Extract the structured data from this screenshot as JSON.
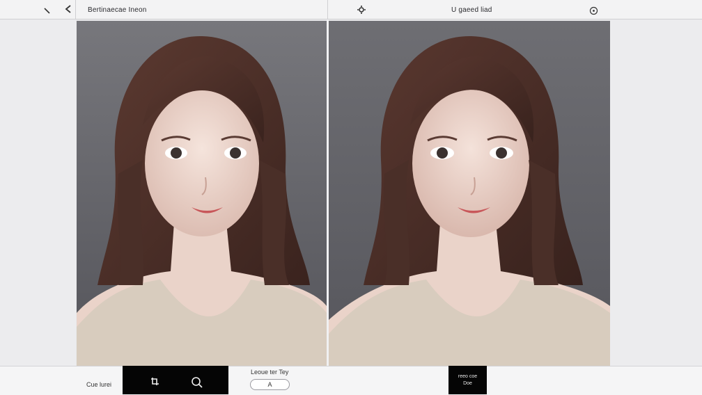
{
  "header": {
    "left_title": "Bertinaecae Ineon",
    "right_title": "U gaeed liad",
    "icons": [
      "pen-icon",
      "back-chevron-icon",
      "settings-icon",
      "help-icon"
    ]
  },
  "viewer": {
    "left_panel_name": "original-photo",
    "right_panel_name": "edited-photo",
    "background": "#5e5e64"
  },
  "footer": {
    "left_label": "Cue lurei",
    "toolbar_icons": [
      "crop-icon",
      "zoom-icon"
    ],
    "center_label": "Leoue ter Tey",
    "center_input": "A",
    "right_button_line1": "reeo coe",
    "right_button_line2": "Doe"
  }
}
